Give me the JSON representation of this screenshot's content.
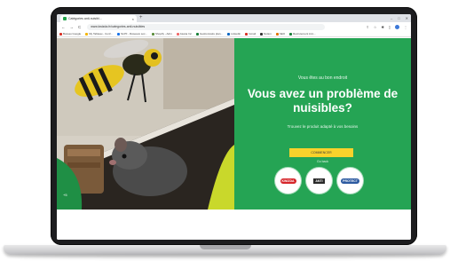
{
  "browser": {
    "tab_title": "Catégories anti-nuisibl...",
    "tab_close": "×",
    "new_tab": "+",
    "url": "www.kwizda.fr/categories-anti-nuisibles",
    "nav_back": "←",
    "nav_forward": "→",
    "nav_reload": "C",
    "bookmarks": [
      {
        "label": "Bureau Google",
        "color": "#d93025"
      },
      {
        "label": "My Tableau - Conf...",
        "color": "#f4b400"
      },
      {
        "label": "SLPF - Réseaux soc...",
        "color": "#1a73e8"
      },
      {
        "label": "Shopify - Adm",
        "color": "#5e8e3e"
      },
      {
        "label": "Asana Inc",
        "color": "#f06a6a"
      },
      {
        "label": "Gestionnaire plan...",
        "color": "#188038"
      },
      {
        "label": "Linkedin",
        "color": "#0a66c2"
      },
      {
        "label": "Gmail",
        "color": "#d93025"
      },
      {
        "label": "Notion",
        "color": "#333333"
      },
      {
        "label": "SEO",
        "color": "#e37400"
      },
      {
        "label": "Recrutement Ann...",
        "color": "#188038"
      }
    ]
  },
  "hero": {
    "overline": "Vous êtes au bon endroit",
    "headline": "Vous avez un problème de nuisibles?",
    "subline": "Trouvez le produit adapté à vos besoins",
    "cta_label": "COMMENCER",
    "small_link": "Go back",
    "corner_mark": "+5",
    "brand_logos": [
      "KWIZDA",
      "ANTI",
      "PROTECT"
    ],
    "green": "#25a454",
    "cta_color": "#f9d22b"
  }
}
